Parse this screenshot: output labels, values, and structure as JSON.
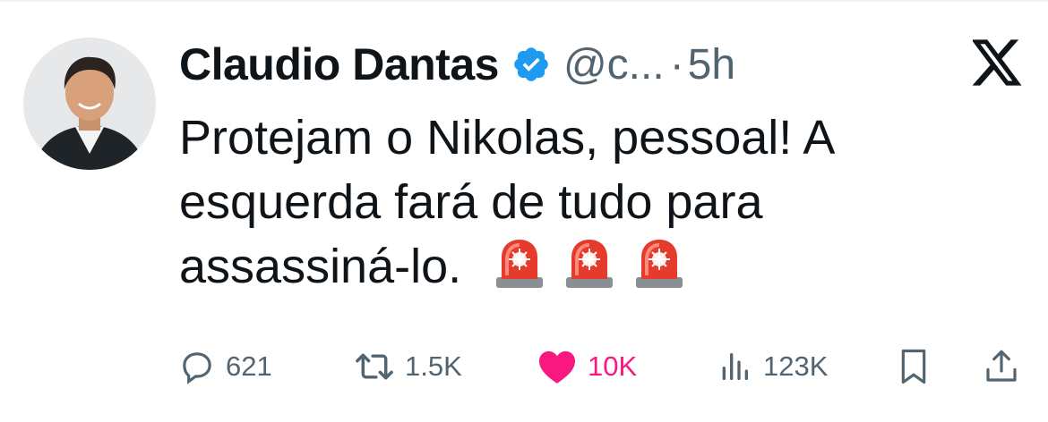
{
  "author": {
    "display_name": "Claudio Dantas",
    "handle": "@c...",
    "separator": "·",
    "time": "5h",
    "verified": true,
    "avatar_icon": "user-avatar-photo"
  },
  "platform_logo": "x-logo-icon",
  "tweet": {
    "text": "Protejam o Nikolas, pessoal! A esquerda fará de tudo para assassiná-lo.",
    "emojis": [
      "police-car-light",
      "police-car-light",
      "police-car-light"
    ]
  },
  "actions": {
    "replies": "621",
    "reposts": "1.5K",
    "likes": "10K",
    "views": "123K"
  },
  "colors": {
    "text_primary": "#0f1419",
    "text_secondary": "#536471",
    "verified_blue": "#1d9bf0",
    "like_pink": "#f91880"
  }
}
